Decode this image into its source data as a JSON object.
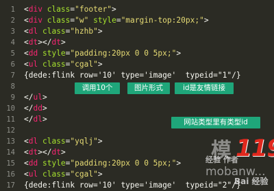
{
  "editor": {
    "lines": [
      {
        "n": "1",
        "code": "<div class=\"footer\">"
      },
      {
        "n": "2",
        "code": "<div class=\"w\" style=\"margin-top:20px;\">"
      },
      {
        "n": "3",
        "code": "<dl class=\"hzhb\">"
      },
      {
        "n": "4",
        "code": "<dt></dt>"
      },
      {
        "n": "5",
        "code": "<dd style=\"padding:20px 0 0 5px;\">"
      },
      {
        "n": "6",
        "code": "<ul class=\"cgal\">"
      },
      {
        "n": "7",
        "code": "{dede:flink row='10' type='image'  typeid=\"1\"/}"
      },
      {
        "n": "8",
        "code": ""
      },
      {
        "n": "9",
        "code": "</ul>"
      },
      {
        "n": "10",
        "code": "</dd>"
      },
      {
        "n": "11",
        "code": "</dl>"
      },
      {
        "n": "12",
        "code": ""
      },
      {
        "n": "13",
        "code": "<dl class=\"yqlj\">"
      },
      {
        "n": "14",
        "code": "<dt></dt>"
      },
      {
        "n": "15",
        "code": "<dd style=\"padding:20px 0 0 5px;\">"
      },
      {
        "n": "16",
        "code": "<ul class=\"cgal\">"
      },
      {
        "n": "17",
        "code": "{dede:flink row='10' type='image'  typeid=\"2\"/}"
      }
    ]
  },
  "annotations": {
    "row_label": "调用10个",
    "type_label": "图片形式",
    "typeid_label": "id是友情链接",
    "site_type_label": "网站类型里有类型id"
  },
  "watermark": {
    "brand_number": "119",
    "brand_char": "模",
    "slogan": "经验 作者",
    "domain": "mobanw...",
    "baidu": "Bai 经验"
  },
  "colors": {
    "background": "#2b2b24",
    "tag": "#f92672",
    "attr": "#a6e22e",
    "string": "#e6db74",
    "annotation": "#1fa67a"
  }
}
